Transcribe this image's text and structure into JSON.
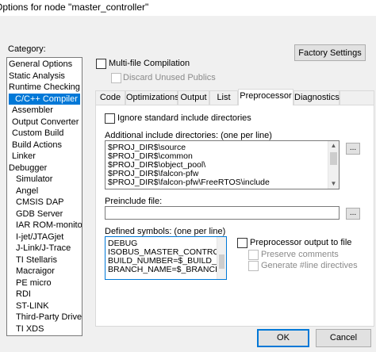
{
  "window": {
    "title": "Options for node \"master_controller\""
  },
  "category": {
    "label": "Category:",
    "items": [
      "General Options",
      "Static Analysis",
      "Runtime Checking",
      "C/C++ Compiler",
      "Assembler",
      "Output Converter",
      "Custom Build",
      "Build Actions",
      "Linker",
      "Debugger",
      "Simulator",
      "Angel",
      "CMSIS DAP",
      "GDB Server",
      "IAR ROM-monitor",
      "I-jet/JTAGjet",
      "J-Link/J-Trace",
      "TI Stellaris",
      "Macraigor",
      "PE micro",
      "RDI",
      "ST-LINK",
      "Third-Party Driver",
      "TI XDS"
    ],
    "selected": "C/C++ Compiler"
  },
  "top": {
    "factory_settings": "Factory Settings",
    "multi_file": "Multi-file Compilation",
    "discard_unused": "Discard Unused Publics"
  },
  "tabs": [
    "Code",
    "Optimizations",
    "Output",
    "List",
    "Preprocessor",
    "Diagnostics"
  ],
  "active_tab": "Preprocessor",
  "preprocessor": {
    "ignore_std": "Ignore standard include directories",
    "include_label": "Additional include directories: (one per line)",
    "include_dirs": [
      "$PROJ_DIR$\\source",
      "$PROJ_DIR$\\common",
      "$PROJ_DIR$\\object_pool\\",
      "$PROJ_DIR$\\falcon-pfw",
      "$PROJ_DIR$\\falcon-pfw\\FreeRTOS\\include"
    ],
    "browse": "...",
    "preinclude_label": "Preinclude file:",
    "preinclude_value": "",
    "defined_label": "Defined symbols: (one per line)",
    "defined_symbols": [
      "DEBUG",
      "ISOBUS_MASTER_CONTROL",
      "BUILD_NUMBER=$_BUILD_N",
      "BRANCH_NAME=$_BRANCH_"
    ],
    "pp_output": "Preprocessor output to file",
    "preserve_comments": "Preserve comments",
    "generate_line": "Generate #line directives"
  },
  "buttons": {
    "ok": "OK",
    "cancel": "Cancel"
  }
}
